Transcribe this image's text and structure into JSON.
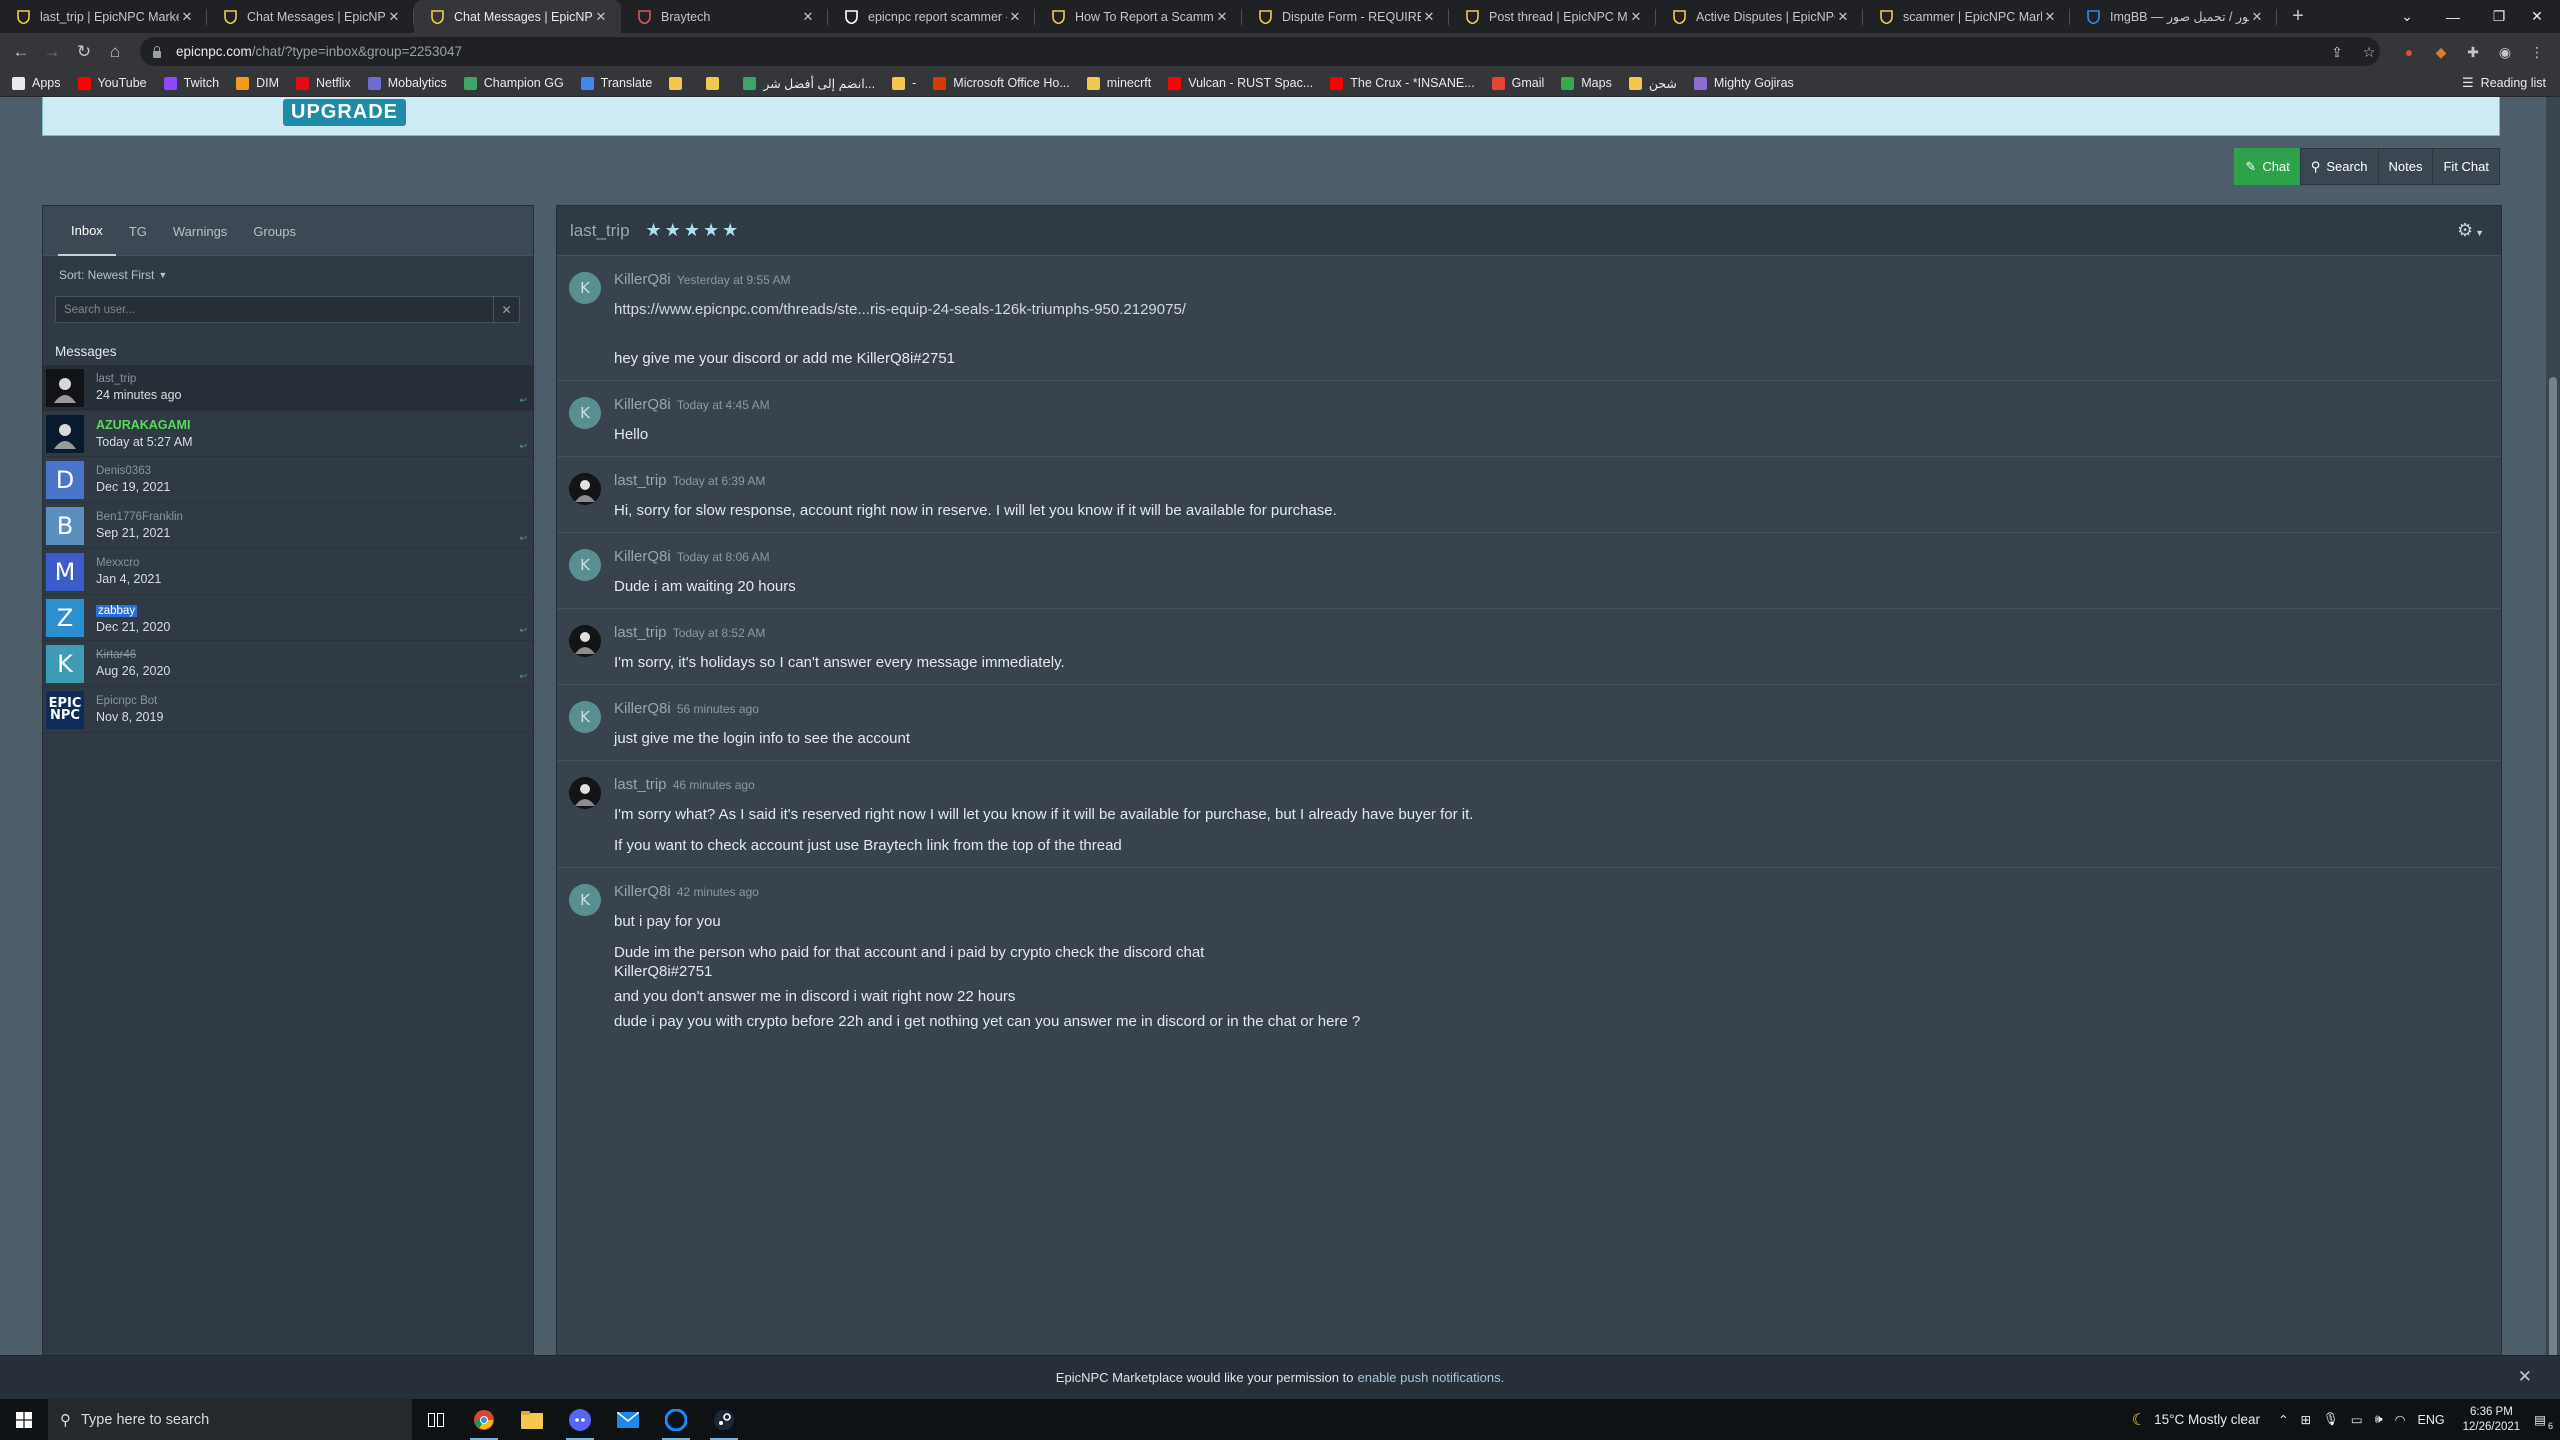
{
  "browser": {
    "tabs": [
      {
        "title": "last_trip | EpicNPC Marketplace",
        "icon": "epicnpc-shield-icon",
        "active": false
      },
      {
        "title": "Chat Messages | EpicNPC Marketplace",
        "icon": "epicnpc-shield-icon",
        "active": false
      },
      {
        "title": "Chat Messages | EpicNPC Marketplace",
        "icon": "epicnpc-shield-icon",
        "active": true
      },
      {
        "title": "Braytech",
        "icon": "braytech-icon",
        "active": false
      },
      {
        "title": "epicnpc report scammer - Google Search",
        "icon": "google-icon",
        "active": false
      },
      {
        "title": "How To Report a Scammer",
        "icon": "epicnpc-shield-icon",
        "active": false
      },
      {
        "title": "Dispute Form - REQUIRED",
        "icon": "epicnpc-shield-icon",
        "active": false
      },
      {
        "title": "Post thread | EpicNPC Marketplace",
        "icon": "epicnpc-shield-icon",
        "active": false
      },
      {
        "title": "Active Disputes | EpicNPC",
        "icon": "epicnpc-shield-icon",
        "active": false
      },
      {
        "title": "scammer | EpicNPC Marketplace",
        "icon": "epicnpc-shield-icon",
        "active": false
      },
      {
        "title": "ImgBB — رفع الصور / تحميل صور",
        "icon": "imgbb-icon",
        "active": false
      }
    ],
    "url_host": "epicnpc.com",
    "url_path": "/chat/?type=inbox&group=2253047",
    "bookmarks": [
      {
        "label": "Apps",
        "icon": "apps-grid-icon",
        "color": "#e8eaed"
      },
      {
        "label": "YouTube",
        "icon": "youtube-icon",
        "color": "#ff0000"
      },
      {
        "label": "Twitch",
        "icon": "twitch-icon",
        "color": "#9146ff"
      },
      {
        "label": "DIM",
        "icon": "dim-icon",
        "color": "#f29b1d"
      },
      {
        "label": "Netflix",
        "icon": "netflix-icon",
        "color": "#e50914"
      },
      {
        "label": "Mobalytics",
        "icon": "mobalytics-icon",
        "color": "#6f6bd6"
      },
      {
        "label": "Champion GG",
        "icon": "championgg-icon",
        "color": "#3aa66a"
      },
      {
        "label": "Translate",
        "icon": "translate-icon",
        "color": "#4285f4"
      },
      {
        "label": "",
        "icon": "folder-icon",
        "color": "#f2c94c"
      },
      {
        "label": "",
        "icon": "emoji-icon",
        "color": "#f2c94c"
      },
      {
        "label": "انضم إلى أفضل شر...",
        "icon": "site-icon",
        "color": "#3aa66a"
      },
      {
        "label": "-",
        "icon": "folder-icon",
        "color": "#f2c94c"
      },
      {
        "label": "Microsoft Office Ho...",
        "icon": "office-icon",
        "color": "#d83b01"
      },
      {
        "label": "minecrft",
        "icon": "folder-icon",
        "color": "#f2c94c"
      },
      {
        "label": "Vulcan - RUST Spac...",
        "icon": "youtube-icon",
        "color": "#ff0000"
      },
      {
        "label": "The Crux - *INSANE...",
        "icon": "youtube-icon",
        "color": "#ff0000"
      },
      {
        "label": "Gmail",
        "icon": "gmail-icon",
        "color": "#ea4335"
      },
      {
        "label": "Maps",
        "icon": "maps-icon",
        "color": "#34a853"
      },
      {
        "label": "شحن",
        "icon": "folder-icon",
        "color": "#f2c94c"
      },
      {
        "label": "Mighty Gojiras",
        "icon": "site-icon",
        "color": "#8e6bd6"
      }
    ],
    "reading_list": "Reading list"
  },
  "banner": {
    "upgrade_label": "UPGRADE"
  },
  "actions": {
    "chat": "Chat",
    "search": "Search",
    "notes": "Notes",
    "fit_chat": "Fit Chat"
  },
  "sidebar": {
    "tabs": [
      "Inbox",
      "TG",
      "Warnings",
      "Groups"
    ],
    "active_tab": "Inbox",
    "sort_label": "Sort: Newest First",
    "search_placeholder": "Search user...",
    "messages_heading": "Messages",
    "conversations": [
      {
        "name": "last_trip",
        "date": "24 minutes ago",
        "avatar": "avatar-photo-icon",
        "letter": "",
        "avatar_color": "#111317",
        "name_color": "#8894a0",
        "active": true,
        "replied": true
      },
      {
        "name": "AZURAKAGAMI",
        "date": "Today at 5:27 AM",
        "avatar": "avatar-photo-icon",
        "letter": "",
        "avatar_color": "#0a1a2e",
        "name_color": "#59d85c",
        "active": false,
        "replied": true
      },
      {
        "name": "Denis0363",
        "date": "Dec 19, 2021",
        "avatar": "avatar-letter-icon",
        "letter": "D",
        "avatar_color": "#4a74c9",
        "name_color": "#8894a0",
        "active": false,
        "replied": false
      },
      {
        "name": "Ben1776Franklin",
        "date": "Sep 21, 2021",
        "avatar": "avatar-letter-icon",
        "letter": "B",
        "avatar_color": "#5a8fc0",
        "name_color": "#8894a0",
        "active": false,
        "replied": true
      },
      {
        "name": "Mexxcro",
        "date": "Jan 4, 2021",
        "avatar": "avatar-letter-icon",
        "letter": "M",
        "avatar_color": "#3b5cc9",
        "name_color": "#8894a0",
        "active": false,
        "replied": false
      },
      {
        "name": "zabbay",
        "date": "Dec 21, 2020",
        "avatar": "avatar-letter-icon",
        "letter": "Z",
        "avatar_color": "#2c8fd0",
        "name_color": "#ffffff",
        "active": false,
        "replied": true
      },
      {
        "name": "Kirtar46",
        "date": "Aug 26, 2020",
        "avatar": "avatar-letter-icon",
        "letter": "K",
        "avatar_color": "#3e9cb6",
        "name_color": "#8894a0",
        "active": false,
        "replied": true
      },
      {
        "name": "Epicnpc Bot",
        "date": "Nov 8, 2019",
        "avatar": "epicnpc-logo-icon",
        "letter": "",
        "avatar_color": "#0e2b59",
        "name_color": "#8894a0",
        "active": false,
        "replied": false
      }
    ]
  },
  "chat": {
    "partner": "last_trip",
    "rating_stars": 5,
    "messages": [
      {
        "author": "KillerQ8i",
        "time": "Yesterday at 9:55 AM",
        "kind": "k",
        "lines": [
          "https://www.epicnpc.com/threads/ste...ris-equip-24-seals-126k-triumphs-950.2129075/",
          "hey give me your discord or add me KillerQ8i#2751"
        ]
      },
      {
        "author": "KillerQ8i",
        "time": "Today at 4:45 AM",
        "kind": "k",
        "lines": [
          "Hello"
        ]
      },
      {
        "author": "last_trip",
        "time": "Today at 6:39 AM",
        "kind": "lt",
        "lines": [
          "Hi, sorry for slow response, account right now in reserve. I will let you know if it will be available for purchase."
        ]
      },
      {
        "author": "KillerQ8i",
        "time": "Today at 8:06 AM",
        "kind": "k",
        "lines": [
          "Dude i am waiting 20 hours"
        ]
      },
      {
        "author": "last_trip",
        "time": "Today at 8:52 AM",
        "kind": "lt",
        "lines": [
          "I'm sorry, it's holidays so I can't answer every message immediately."
        ]
      },
      {
        "author": "KillerQ8i",
        "time": "56 minutes ago",
        "kind": "k",
        "lines": [
          "just give me the login info to see the account"
        ]
      },
      {
        "author": "last_trip",
        "time": "46 minutes ago",
        "kind": "lt",
        "lines": [
          "I'm sorry what? As I said it's reserved right now I will let you know if it will be available for purchase, but I already have buyer for it.",
          "If you want to check account just use Braytech link from the top of the thread"
        ]
      },
      {
        "author": "KillerQ8i",
        "time": "42 minutes ago",
        "kind": "k",
        "lines": [
          "but i pay for you",
          "Dude im the person who paid for that account and i paid by crypto check the discord chat\nKillerQ8i#2751",
          "and you don't answer me in discord i wait right now 22 hours",
          "dude i pay you with crypto before 22h and i get nothing yet can you answer me in discord or in the chat or here ?"
        ]
      }
    ]
  },
  "notification": {
    "text": "EpicNPC Marketplace would like your permission to",
    "link": "enable push notifications."
  },
  "taskbar": {
    "search_placeholder": "Type here to search",
    "weather": "15°C  Mostly clear",
    "language": "ENG",
    "time": "6:36 PM",
    "date": "12/26/2021",
    "notifications_count": "6"
  }
}
